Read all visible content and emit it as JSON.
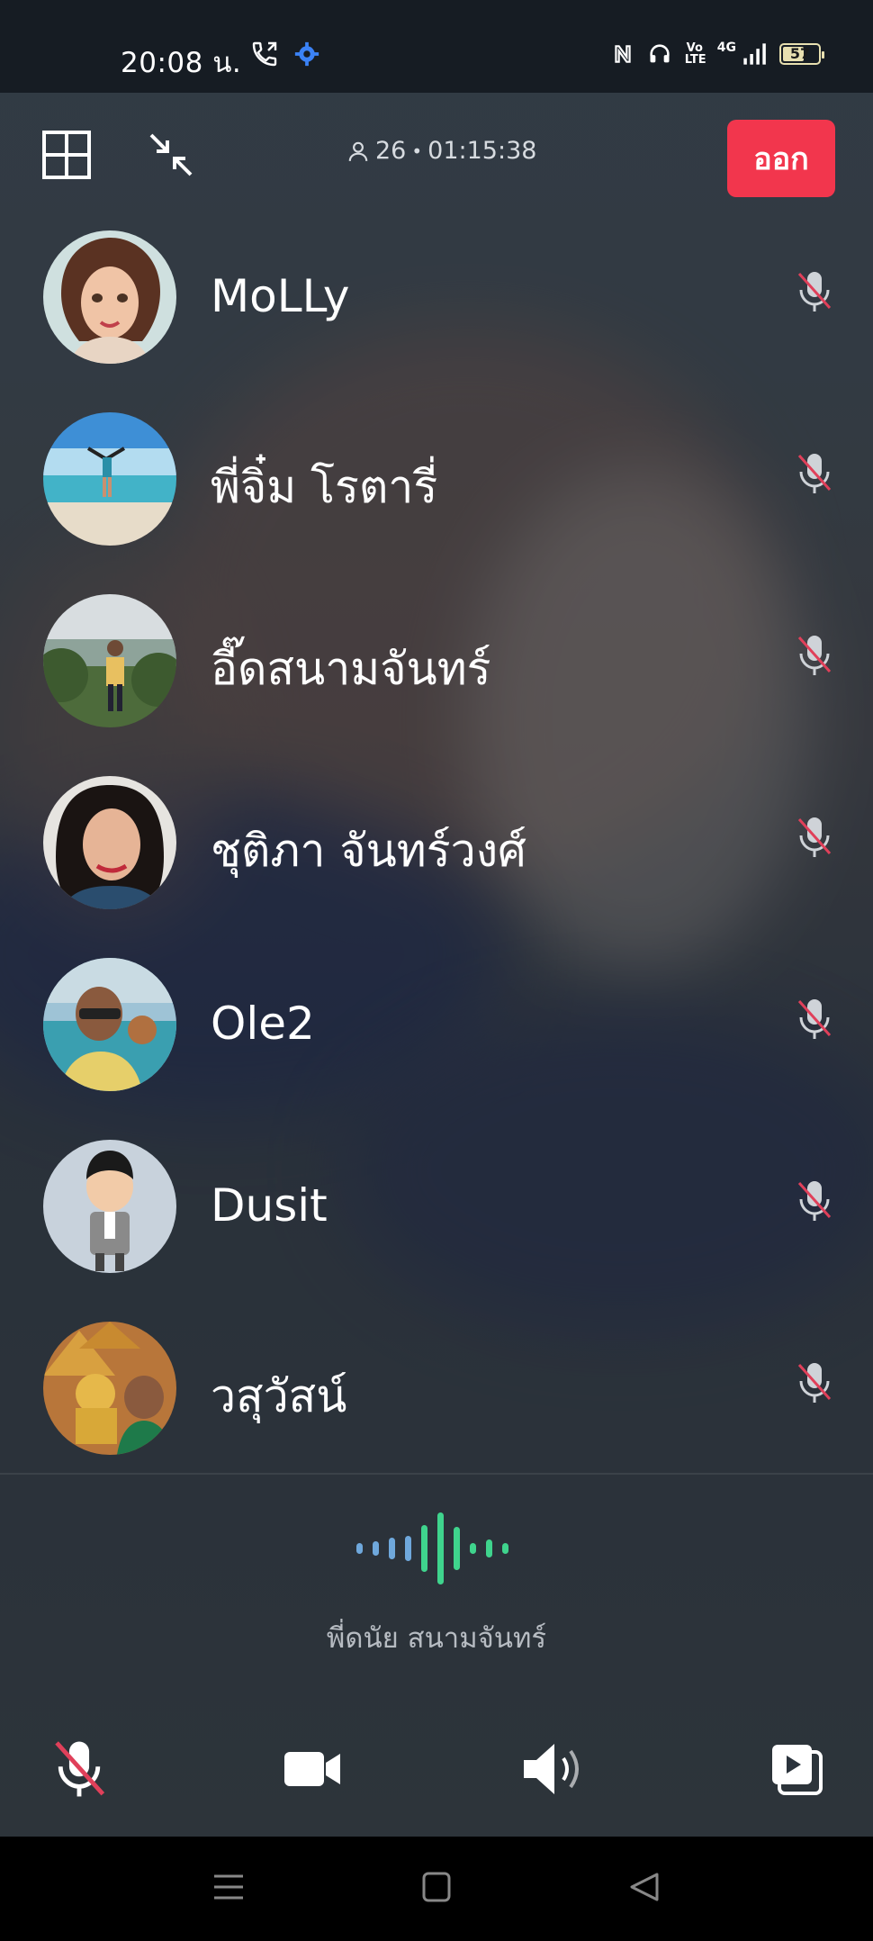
{
  "status_bar": {
    "time": "20:08 น.",
    "battery": "57",
    "network": "4G",
    "volte": "Vo LTE"
  },
  "call": {
    "participant_count": "26",
    "duration": "01:15:38",
    "leave_label": "ออก"
  },
  "participants": [
    {
      "name": "MoLLy",
      "muted": true
    },
    {
      "name": "พี่จิ๋ม โรตารี่",
      "muted": true
    },
    {
      "name": "อี๊ดสนามจันทร์",
      "muted": true
    },
    {
      "name": "ชุติภา จันทร์วงศ์",
      "muted": true
    },
    {
      "name": "Ole2",
      "muted": true
    },
    {
      "name": "Dusit",
      "muted": true
    },
    {
      "name": "วสุวัสน์",
      "muted": true
    }
  ],
  "speaker": {
    "name": "พี่ดนัย สนามจันทร์"
  },
  "controls": {
    "mic": "mic-off-icon",
    "video": "video-camera-icon",
    "speaker": "speaker-icon",
    "screen_share": "screen-share-icon"
  },
  "colors": {
    "leave_button": "#f2364d",
    "wave_blue": "#6fa8dc",
    "wave_green": "#3fd48d",
    "mute_red": "#e0405a"
  }
}
